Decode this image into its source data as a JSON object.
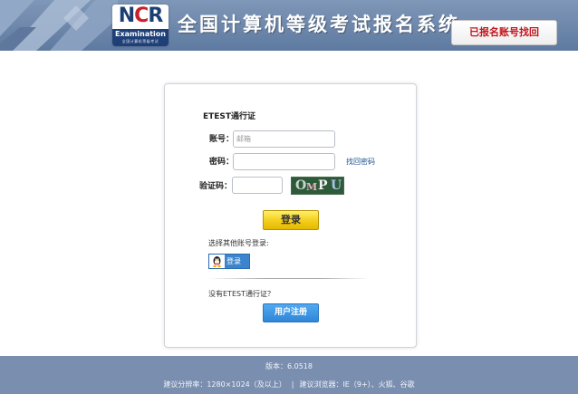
{
  "header": {
    "logo_main": "N",
    "logo_c": "C",
    "logo_r": "R",
    "logo_sub": "Examination",
    "logo_sub2": "全国计算机等级考试",
    "title": "全国计算机等级考试报名系统",
    "recover_button": "已报名账号找回"
  },
  "login": {
    "title": "ETEST通行证",
    "account_label": "账号：",
    "account_placeholder": "邮箱",
    "password_label": "密码：",
    "forgot_link": "找回密码",
    "captcha_label": "验证码：",
    "captcha_chars": [
      "O",
      "M",
      "P",
      "U"
    ],
    "login_button": "登录",
    "other_login_label": "选择其他账号登录:",
    "qq_login_label": "登录",
    "no_pass_label": "没有ETEST通行证？",
    "register_button": "用户注册"
  },
  "footer": {
    "version": "版本：6.0518",
    "resolution_tip": "建议分辨率：1280×1024（及以上）",
    "separator": "|",
    "browser_tip": "建议浏览器：IE（9+）、火狐、谷歌"
  },
  "colors": {
    "header_blue": "#6d87ab",
    "footer_blue": "#7a8eb0",
    "brand_red": "#c2141b",
    "link_blue": "#1d4f91",
    "login_yellow": "#f3cd1a",
    "register_blue": "#2f86d8"
  }
}
